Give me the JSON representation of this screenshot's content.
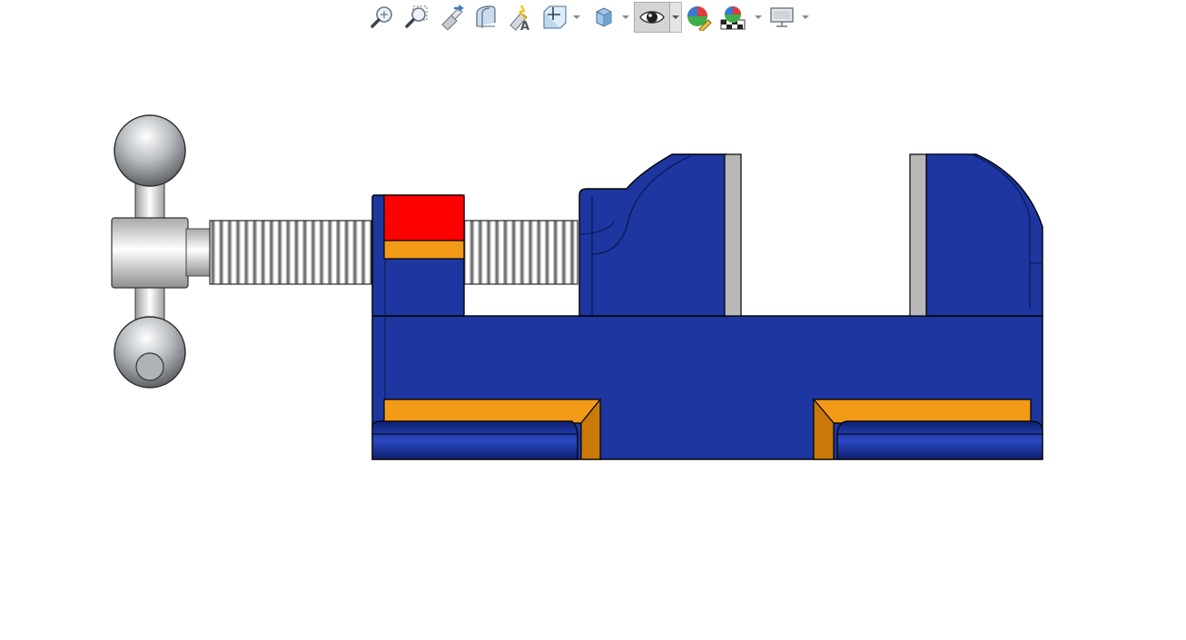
{
  "toolbar": {
    "items": [
      {
        "name": "zoom-to-fit-icon",
        "icon": "zoom-to-fit"
      },
      {
        "name": "zoom-to-area-icon",
        "icon": "zoom-to-area"
      },
      {
        "name": "previous-view-icon",
        "icon": "previous-view"
      },
      {
        "name": "section-view-icon",
        "icon": "section-view"
      },
      {
        "name": "dynamic-annotation-views-icon",
        "icon": "dynamic-annotation"
      },
      {
        "name": "view-orientation-icon",
        "icon": "view-orientation",
        "dropdown": true
      },
      {
        "name": "display-style-icon",
        "icon": "display-style",
        "dropdown": true
      },
      {
        "name": "hide-show-items-icon",
        "icon": "hide-show",
        "dropdown": true,
        "active": true
      },
      {
        "name": "edit-appearance-icon",
        "icon": "edit-appearance"
      },
      {
        "name": "apply-scene-icon",
        "icon": "apply-scene",
        "dropdown": true
      },
      {
        "name": "view-settings-icon",
        "icon": "view-settings",
        "dropdown": true
      }
    ]
  },
  "colors": {
    "body_blue": "#1e36a0",
    "body_blue_dark": "#142780",
    "cut_orange": "#f39a16",
    "cut_orange_dark": "#c97a08",
    "jaw_red": "#ff0000",
    "jaw_plate_gray": "#b8b8b8",
    "screw_gray": "#9a9a9a",
    "handle_white": "#f2f2f2",
    "background": "#ffffff"
  }
}
